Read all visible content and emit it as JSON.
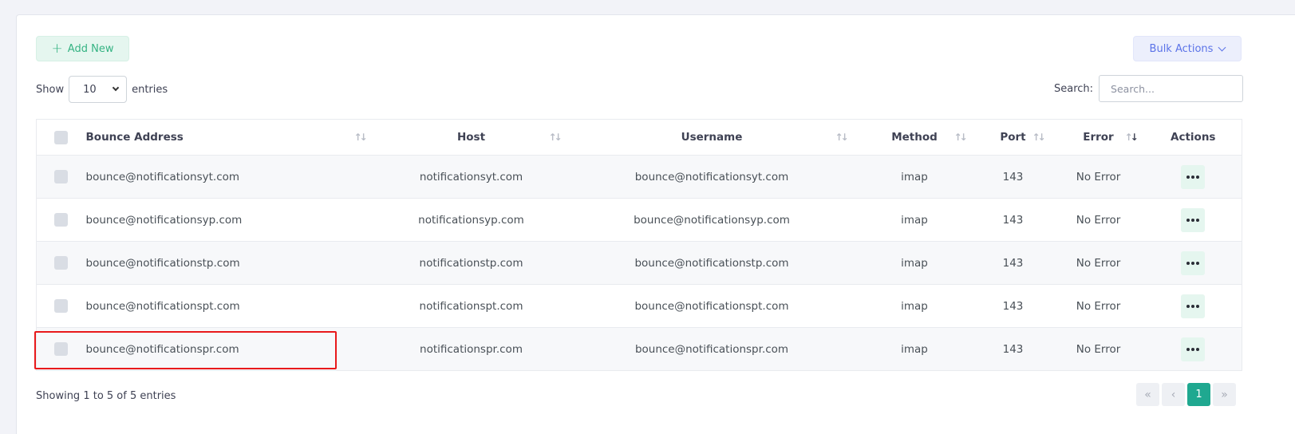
{
  "toolbar": {
    "add_new_label": "Add New",
    "bulk_actions_label": "Bulk Actions"
  },
  "length": {
    "show_label": "Show",
    "value": "10",
    "entries_label": "entries"
  },
  "search": {
    "label": "Search:",
    "placeholder": "Search..."
  },
  "table": {
    "columns": [
      "Bounce Address",
      "Host",
      "Username",
      "Method",
      "Port",
      "Error",
      "Actions"
    ],
    "sorted_column": "Error",
    "rows": [
      {
        "bounce_address": "bounce@notificationsyt.com",
        "host": "notificationsyt.com",
        "username": "bounce@notificationsyt.com",
        "method": "imap",
        "port": "143",
        "error": "No Error"
      },
      {
        "bounce_address": "bounce@notificationsyp.com",
        "host": "notificationsyp.com",
        "username": "bounce@notificationsyp.com",
        "method": "imap",
        "port": "143",
        "error": "No Error"
      },
      {
        "bounce_address": "bounce@notificationstp.com",
        "host": "notificationstp.com",
        "username": "bounce@notificationstp.com",
        "method": "imap",
        "port": "143",
        "error": "No Error"
      },
      {
        "bounce_address": "bounce@notificationspt.com",
        "host": "notificationspt.com",
        "username": "bounce@notificationspt.com",
        "method": "imap",
        "port": "143",
        "error": "No Error"
      },
      {
        "bounce_address": "bounce@notificationspr.com",
        "host": "notificationspr.com",
        "username": "bounce@notificationspr.com",
        "method": "imap",
        "port": "143",
        "error": "No Error"
      }
    ]
  },
  "footer": {
    "info": "Showing 1 to 5 of 5 entries",
    "current_page": "1"
  },
  "colors": {
    "accent_green": "#1fa890",
    "bulk_blue": "#5b73e8",
    "highlight_red": "#e8191b"
  },
  "icons": [
    "plus-icon",
    "chevron-down-icon",
    "sort-icon",
    "more-dots-icon",
    "first-page-icon",
    "prev-page-icon",
    "next-page-icon",
    "last-page-icon"
  ]
}
